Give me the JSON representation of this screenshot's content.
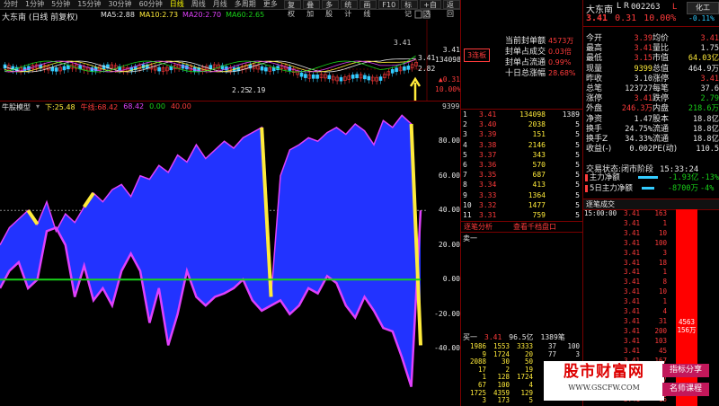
{
  "toolbar": {
    "periods": [
      "分时",
      "1分钟",
      "5分钟",
      "15分钟",
      "30分钟",
      "60分钟",
      "日线",
      "周线",
      "月线",
      "多周期",
      "更多"
    ],
    "active_period": "日线",
    "right_buttons": [
      "复权",
      "叠加",
      "多股",
      "统计",
      "画线",
      "F10",
      "标记",
      "+自选",
      "返回"
    ]
  },
  "stock": {
    "name": "大东南",
    "mode": "(日线 前复权)",
    "code": "002263",
    "price": "3.41",
    "change": "0.31",
    "change_pct": "10.00%",
    "badge": "化工",
    "badge2": "-0.11%",
    "lock_badge": "L R"
  },
  "ma_legend": [
    {
      "label": "MA5:",
      "value": "2.88",
      "color": "#e6e6e6"
    },
    {
      "label": "MA10:",
      "value": "2.73",
      "color": "#ffeb3b"
    },
    {
      "label": "MA20:",
      "value": "2.70",
      "color": "#e040fb"
    },
    {
      "label": "MA60:",
      "value": "2.65",
      "color": "#19d219"
    }
  ],
  "price_annotations": {
    "high": "3.41",
    "low": "2.25",
    "low2": "2.19",
    "right_hi": "3.41",
    "right_vol": "134098",
    "right_pct": "▲0.31",
    "right_pct2": "10.00%",
    "hi_mark": "3.41",
    "lo_mark": "2.82"
  },
  "seal": {
    "tag": "3连板",
    "lines": [
      {
        "label": "当前封单额",
        "value": "4573万"
      },
      {
        "label": "封单占成交",
        "value": "0.03倍"
      },
      {
        "label": "封单占流通",
        "value": "0.99%"
      },
      {
        "label": "十日总涨幅",
        "value": "28.68%"
      }
    ]
  },
  "indicator": {
    "name": "牛股模型",
    "values": [
      {
        "label": "下:",
        "value": "25.48",
        "color": "#ffeb3b"
      },
      {
        "label": "牛线:",
        "value": "68.42",
        "color": "#ff3b3b"
      },
      {
        "label": "",
        "value": "68.42",
        "color": "#e040fb"
      },
      {
        "label": "",
        "value": "0.00",
        "color": "#19d219"
      },
      {
        "label": "",
        "value": "40.00",
        "color": "#ff3b3b"
      }
    ],
    "axis": [
      "80.00",
      "60.00",
      "40.00",
      "20.00",
      "0.00",
      "-20.00",
      "-40.00"
    ],
    "mid_value": "9399",
    "series_fill": [
      20,
      30,
      35,
      40,
      32,
      45,
      28,
      38,
      33,
      42,
      50,
      45,
      52,
      55,
      48,
      60,
      58,
      66,
      62,
      72,
      68,
      78,
      70,
      75,
      80,
      76,
      82,
      85,
      88,
      -10,
      60,
      75,
      78,
      82,
      80,
      85,
      88,
      84,
      90,
      86,
      78,
      92,
      88,
      95,
      90,
      -38
    ],
    "series_line": [
      -5,
      5,
      10,
      -5,
      0,
      28,
      30,
      20,
      -10,
      8,
      -12,
      -5,
      -15,
      5,
      15,
      5,
      -25,
      -5,
      -38,
      -20,
      5,
      -10,
      -15,
      -10,
      -8,
      -5,
      0,
      -12,
      -18,
      -15,
      -12,
      -20,
      -15,
      -5,
      -8,
      2,
      -2,
      -15,
      -22,
      -10,
      -18,
      -28,
      -30,
      -45,
      -62,
      40
    ],
    "zero_color": "#19d219"
  },
  "order_book": {
    "sell": [],
    "buy": [
      {
        "lvl": "1",
        "price": "3.41",
        "vol": "134098",
        "extra": "1389"
      },
      {
        "lvl": "2",
        "price": "3.40",
        "vol": "2038",
        "extra": "5"
      },
      {
        "lvl": "3",
        "price": "3.39",
        "vol": "151",
        "extra": "5"
      },
      {
        "lvl": "4",
        "price": "3.38",
        "vol": "2146",
        "extra": "5"
      },
      {
        "lvl": "5",
        "price": "3.37",
        "vol": "343",
        "extra": "5"
      },
      {
        "lvl": "6",
        "price": "3.36",
        "vol": "570",
        "extra": "5"
      },
      {
        "lvl": "7",
        "price": "3.35",
        "vol": "687",
        "extra": "5"
      },
      {
        "lvl": "8",
        "price": "3.34",
        "vol": "413",
        "extra": "5"
      },
      {
        "lvl": "9",
        "price": "3.33",
        "vol": "1364",
        "extra": "5"
      },
      {
        "lvl": "10",
        "price": "3.32",
        "vol": "1477",
        "extra": "5"
      },
      {
        "lvl": "11",
        "price": "3.31",
        "vol": "759",
        "extra": "5"
      }
    ],
    "tab_left": "逐笔分析",
    "tab_right": "查看千档盘口",
    "sell1_label": "卖一",
    "buy1": {
      "label": "买一",
      "price": "3.41",
      "vol": "96.5亿",
      "count": "1389笔"
    },
    "queue": [
      [
        "1986",
        "1553",
        "3333",
        "37",
        "100"
      ],
      [
        "9",
        "1724",
        "20",
        "77",
        "3"
      ],
      [
        "2088",
        "30",
        "50",
        "",
        ""
      ],
      [
        "17",
        "2",
        "19",
        "",
        ""
      ],
      [
        "1",
        "128",
        "1724",
        "",
        ""
      ],
      [
        "67",
        "100",
        "4",
        "",
        ""
      ],
      [
        "1725",
        "4359",
        "129",
        "",
        ""
      ],
      [
        "3",
        "173",
        "5",
        "",
        ""
      ]
    ]
  },
  "quote": {
    "rows": [
      [
        {
          "k": "今开",
          "v": "3.39",
          "c": "#ff3b3b"
        },
        {
          "k": "均价",
          "v": "3.41",
          "c": "#ff3b3b"
        }
      ],
      [
        {
          "k": "最高",
          "v": "3.41",
          "c": "#ff3b3b"
        },
        {
          "k": "量比",
          "v": "1.75",
          "c": "#e6e6e6"
        }
      ],
      [
        {
          "k": "最低",
          "v": "3.15",
          "c": "#ff3b3b"
        },
        {
          "k": "市值",
          "v": "64.03亿",
          "c": "#ffeb3b"
        }
      ],
      [
        {
          "k": "现量",
          "v": "9399",
          "c": "#ffeb3b"
        },
        {
          "k": "总值",
          "v": "464.9万",
          "c": "#e6e6e6"
        }
      ],
      [
        {
          "k": "昨收",
          "v": "3.10",
          "c": "#e6e6e6"
        },
        {
          "k": "涨停",
          "v": "3.41",
          "c": "#ff3b3b"
        }
      ],
      [
        {
          "k": "总笔",
          "v": "123727",
          "c": "#e6e6e6"
        },
        {
          "k": "每笔",
          "v": "37.6",
          "c": "#e6e6e6"
        }
      ],
      [
        {
          "k": "涨停",
          "v": "3.41",
          "c": "#ff3b3b"
        },
        {
          "k": "跌停",
          "v": "2.79",
          "c": "#19d219"
        }
      ],
      [
        {
          "k": "外盘",
          "v": "246.3万",
          "c": "#ff3b3b"
        },
        {
          "k": "内盘",
          "v": "218.6万",
          "c": "#19d219"
        }
      ],
      [
        {
          "k": "净资",
          "v": "1.47",
          "c": "#e6e6e6"
        },
        {
          "k": "股本",
          "v": "18.8亿",
          "c": "#e6e6e6"
        }
      ],
      [
        {
          "k": "换手",
          "v": "24.75%",
          "c": "#e6e6e6"
        },
        {
          "k": "流通",
          "v": "18.8亿",
          "c": "#e6e6e6"
        }
      ],
      [
        {
          "k": "换手Z",
          "v": "34.33%",
          "c": "#e6e6e6"
        },
        {
          "k": "流通",
          "v": "18.8亿",
          "c": "#e6e6e6"
        }
      ],
      [
        {
          "k": "收益(-)",
          "v": "0.002",
          "c": "#e6e6e6"
        },
        {
          "k": "PE(动)",
          "v": "110.5",
          "c": "#e6e6e6"
        }
      ]
    ],
    "status_label": "交易状态:",
    "status": "闭市阶段",
    "time": "15:33:24",
    "flow": [
      {
        "k": "主力净额",
        "v": "-1.93亿",
        "v2": "-13%",
        "c": "#19d219"
      },
      {
        "k": "5日主力净额",
        "v": "-8700万",
        "v2": "-4%",
        "c": "#19d219"
      }
    ]
  },
  "ticks": {
    "title": "逐笔成交",
    "rows": [
      [
        "15:00:00",
        "3.41",
        "163"
      ],
      [
        "",
        "3.41",
        "1"
      ],
      [
        "",
        "3.41",
        "10"
      ],
      [
        "",
        "3.41",
        "100"
      ],
      [
        "",
        "3.41",
        "3"
      ],
      [
        "",
        "3.41",
        "18"
      ],
      [
        "",
        "3.41",
        "1"
      ],
      [
        "",
        "3.41",
        "8"
      ],
      [
        "",
        "3.41",
        "10"
      ],
      [
        "",
        "3.41",
        "1"
      ],
      [
        "",
        "3.41",
        "4"
      ],
      [
        "",
        "3.41",
        "31"
      ],
      [
        "",
        "3.41",
        "200"
      ],
      [
        "",
        "3.41",
        "103"
      ],
      [
        "",
        "3.41",
        "45"
      ],
      [
        "",
        "3.41",
        "167"
      ],
      [
        "",
        "3.41",
        "3"
      ],
      [
        "",
        "3.41",
        "147"
      ],
      [
        "",
        "3.41",
        "1"
      ],
      [
        "",
        "3.41",
        "15"
      ]
    ],
    "bar_value": "4563",
    "bar_value2": "156万"
  },
  "watermark": {
    "site": "股市财富网",
    "url": "WWW.GSCFW.COM",
    "btn1": "指标分享",
    "btn2": "名师课程"
  }
}
